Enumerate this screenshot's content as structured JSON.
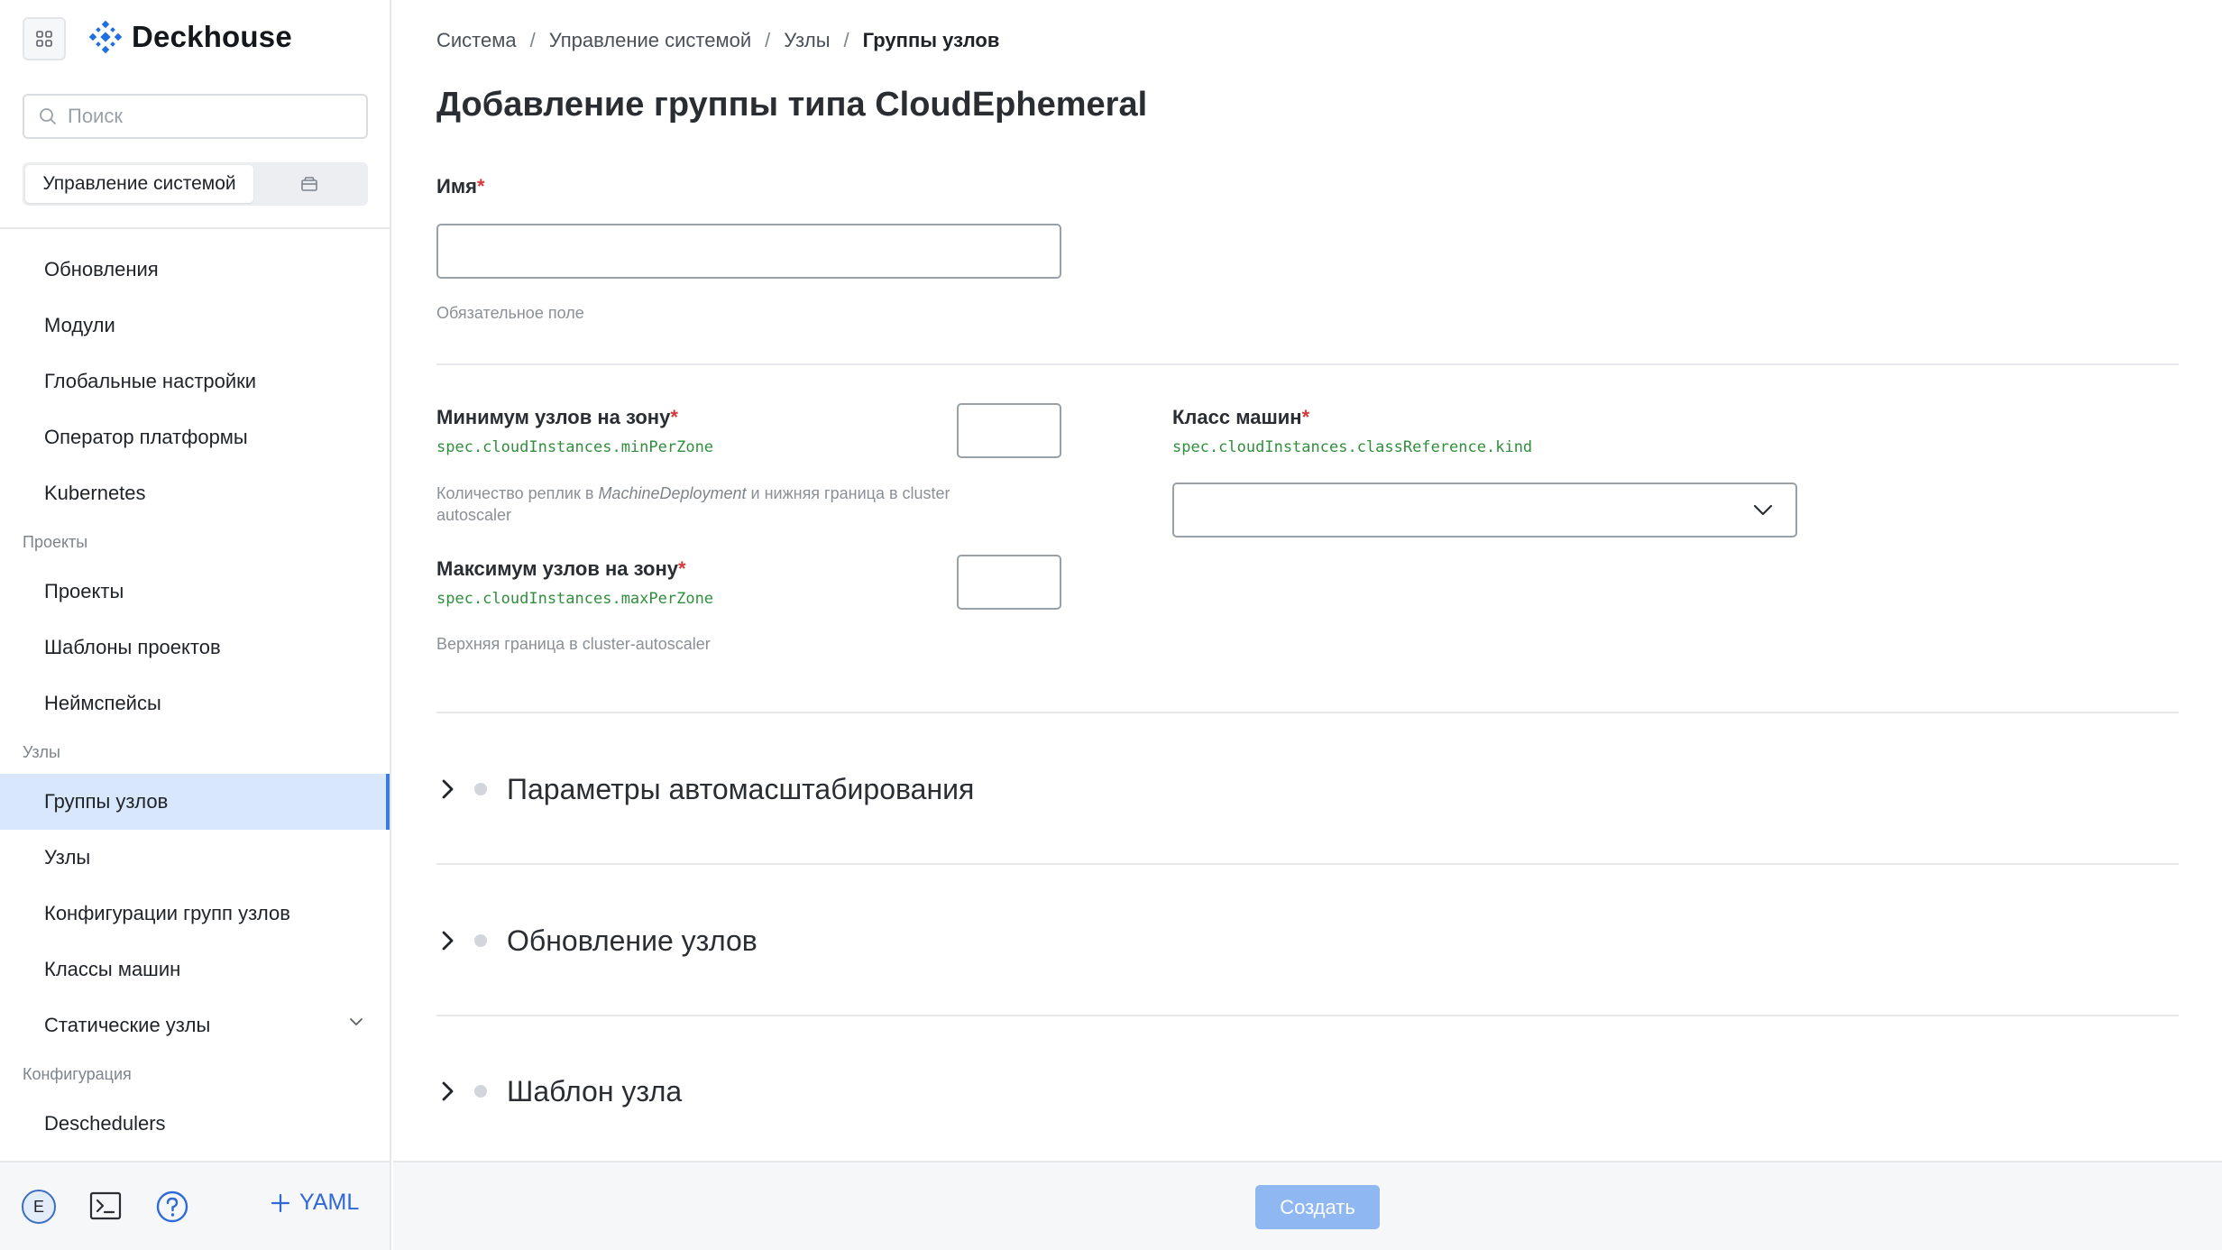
{
  "app": {
    "name": "Deckhouse"
  },
  "search": {
    "placeholder": "Поиск"
  },
  "context": {
    "active_label": "Управление системой"
  },
  "sidebar": {
    "items": [
      {
        "type": "item",
        "label": "Обновления"
      },
      {
        "type": "item",
        "label": "Модули"
      },
      {
        "type": "item",
        "label": "Глобальные настройки"
      },
      {
        "type": "item",
        "label": "Оператор платформы"
      },
      {
        "type": "item",
        "label": "Kubernetes"
      },
      {
        "type": "section",
        "label": "Проекты"
      },
      {
        "type": "item",
        "label": "Проекты"
      },
      {
        "type": "item",
        "label": "Шаблоны проектов"
      },
      {
        "type": "item",
        "label": "Неймспейсы"
      },
      {
        "type": "section",
        "label": "Узлы"
      },
      {
        "type": "item",
        "label": "Группы узлов",
        "active": true
      },
      {
        "type": "item",
        "label": "Узлы"
      },
      {
        "type": "item",
        "label": "Конфигурации групп узлов"
      },
      {
        "type": "item",
        "label": "Классы машин"
      },
      {
        "type": "item",
        "label": "Статические узлы",
        "expandable": true
      },
      {
        "type": "section",
        "label": "Конфигурация"
      },
      {
        "type": "item",
        "label": "Deschedulers"
      }
    ]
  },
  "footer": {
    "avatar_letter": "E",
    "yaml_label": "YAML"
  },
  "breadcrumb": [
    "Система",
    "Управление системой",
    "Узлы",
    "Группы узлов"
  ],
  "page": {
    "title": "Добавление группы типа CloudEphemeral"
  },
  "form": {
    "name": {
      "label": "Имя",
      "value": "",
      "hint": "Обязательное поле"
    },
    "min_per_zone": {
      "label": "Минимум узлов на зону",
      "path": "spec.cloudInstances.minPerZone",
      "value": "",
      "hint_before": "Количество реплик в ",
      "hint_italic": "MachineDeployment",
      "hint_after": " и нижняя граница в cluster autoscaler"
    },
    "max_per_zone": {
      "label": "Максимум узлов на зону",
      "path": "spec.cloudInstances.maxPerZone",
      "value": "",
      "hint": "Верхняя граница в cluster-autoscaler"
    },
    "machine_class": {
      "label": "Класс машин",
      "path": "spec.cloudInstances.classReference.kind",
      "value": ""
    },
    "required_mark": "*"
  },
  "sections": [
    {
      "title": "Параметры автомасштабирования"
    },
    {
      "title": "Обновление узлов"
    },
    {
      "title": "Шаблон узла"
    }
  ],
  "actions": {
    "create_label": "Создать"
  },
  "colors": {
    "accent": "#3b7be0",
    "active_bg": "#d8e7fb",
    "code": "#2f8f3c",
    "required": "#d33a3a"
  }
}
